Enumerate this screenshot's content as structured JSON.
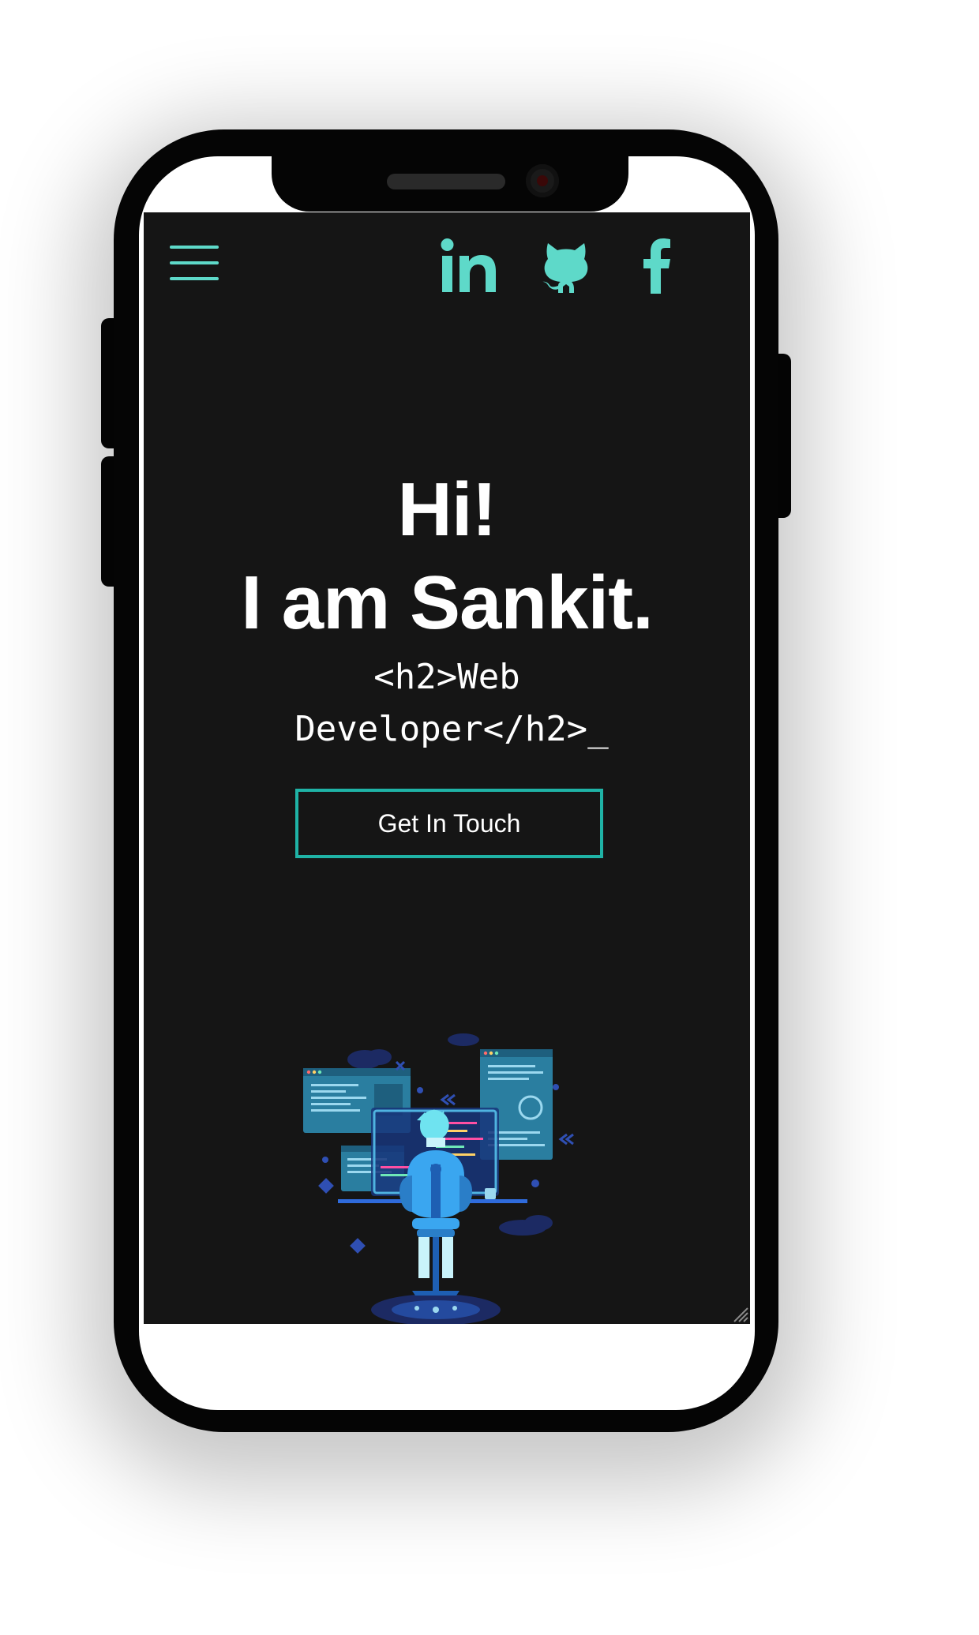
{
  "nav": {
    "menu_icon": "hamburger-menu-icon",
    "social": [
      {
        "name": "LinkedIn",
        "icon": "linkedin-icon"
      },
      {
        "name": "GitHub",
        "icon": "github-icon"
      },
      {
        "name": "Facebook",
        "icon": "facebook-icon"
      }
    ]
  },
  "hero": {
    "greeting": "Hi!",
    "intro": "I am Sankit.",
    "role_line1": "<h2>Web",
    "role_line2": "Developer</h2>",
    "role_cursor": "_",
    "cta_label": "Get In Touch"
  },
  "illustration": {
    "icon": "developer-at-desk-illustration"
  },
  "colors": {
    "accent": "#5ed9c9",
    "button_border": "#1fb3a6",
    "background": "#151515",
    "text": "#ffffff",
    "device": "#050505"
  }
}
